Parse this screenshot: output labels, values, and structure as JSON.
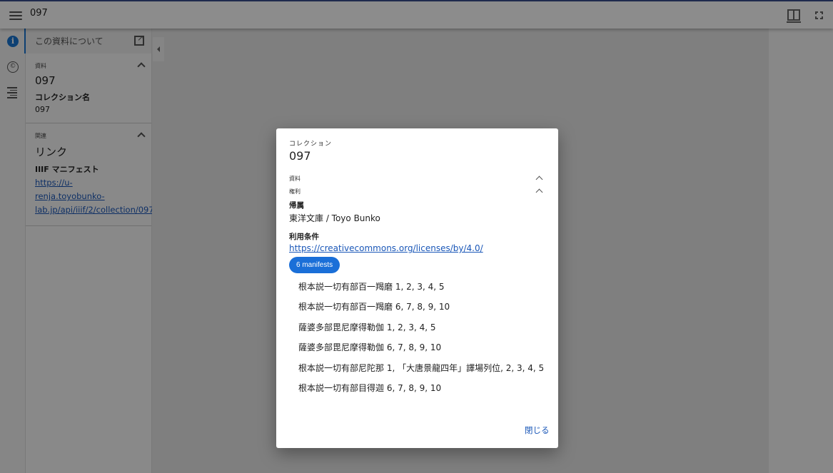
{
  "topbar": {
    "title": "097",
    "menu_icon": "hamburger-menu-icon",
    "book_view_icon": "book-view-icon",
    "fullscreen_icon": "fullscreen-icon"
  },
  "rail": {
    "items": [
      {
        "icon": "info-icon",
        "glyph": "i"
      },
      {
        "icon": "copyright-icon",
        "glyph": "©"
      },
      {
        "icon": "table-of-contents-icon",
        "glyph": ""
      }
    ]
  },
  "sidepanel": {
    "header_label": "この資料について",
    "resource": {
      "kicker": "資料",
      "title": "097",
      "field_label": "コレクション名",
      "field_value": "097"
    },
    "related": {
      "kicker": "関連",
      "title": "リンク",
      "field_label": "IIIF マニフェスト",
      "link_line1": "https://u-renja.toyobunko-",
      "link_line2": "lab.jp/api/iiif/2/collection/097"
    }
  },
  "dialog": {
    "kicker": "コレクション",
    "heading": "097",
    "section_resource": "資料",
    "section_rights": "権利",
    "attribution_label": "帰属",
    "attribution_value": "東洋文庫 / Toyo Bunko",
    "license_label": "利用条件",
    "license_link": "https://creativecommons.org/licenses/by/4.0/",
    "manifests_chip": "6 manifests",
    "manifests": [
      "根本説一切有部百一羯磨 1, 2, 3, 4, 5",
      "根本説一切有部百一羯磨 6, 7, 8, 9, 10",
      "薩婆多部毘尼摩得勒伽 1, 2, 3, 4, 5",
      "薩婆多部毘尼摩得勒伽 6, 7, 8, 9, 10",
      "根本説一切有部尼陀那 1, 「大唐景龍四年」譯場列位, 2, 3, 4, 5",
      "根本説一切有部目得迦 6, 7, 8, 9, 10"
    ],
    "close_label": "閉じる"
  },
  "colors": {
    "accent": "#1a6fd8",
    "link": "#1a57b8",
    "topbar_border": "#3a4e8c"
  }
}
